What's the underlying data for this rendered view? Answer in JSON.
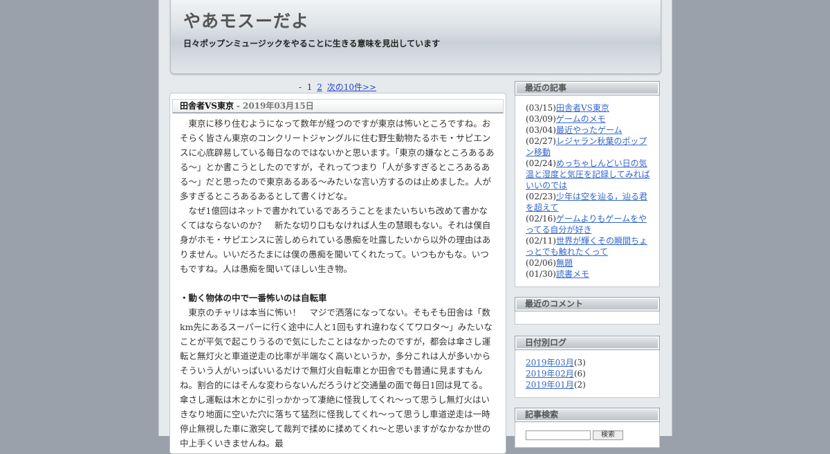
{
  "site": {
    "title": "やあモスーだよ",
    "description": "日々ポップンミュージックをやることに生きる意味を見出しています"
  },
  "pager": {
    "dash": "-",
    "current": "1",
    "page2": "2",
    "next": "次の10件>>"
  },
  "entry": {
    "title": "田舎者VS東京",
    "date": "- 2019年03月15日",
    "paragraphs": [
      "　東京に移り住むようになって数年が経つのですが東京は怖いところですね。おそらく皆さん東京のコンクリートジャングルに住む野生動物たるホモ・サピエンスに心底辟易している毎日なのではないかと思います。「東京の嫌なところあるある～」とか書こうとしたのですが，それってつまり「人が多すぎるところあるある～」だと思ったので東京あるある～みたいな言い方するのは止めました。人が多すぎるところあるあるとして書くけどな。",
      "　なぜ1億回はネットで書かれているであろうことをまたいちいち改めて書かなくてはならないのか？　新たな切り口もなければ人生の慧眼もない。それは僕自身がホモ・サピエンスに苦しめられている愚痴を吐露したいから以外の理由はありません。いいだろたまには僕の愚痴を聞いてくれたって。いつもかもな。いつもですね。人は愚痴を聞いてほしい生き物。",
      "・動く物体の中で一番怖いのは自転車",
      "　東京のチャリは本当に怖い！　マジで洒落になってない。そもそも田舎は「数km先にあるスーパーに行く途中に人と1回もすれ違わなくてワロタ～」みたいなことが平気で起こりうるので気にしたことはなかったのですが，都会は傘さし運転と無灯火と車道逆走の比率が半端なく高いというか，多分これは人が多いからそういう人がいっぱいいるだけで無灯火自転車とか田舎でも普通に見ますもんね。割合的にはそんな変わらないんだろうけど交通量の面で毎日1回は見てる。傘さし運転は木とかに引っかかって凄絶に怪我してくれ～って思うし無灯火はいきなり地面に空いた穴に落ちて猛烈に怪我してくれ～って思うし車道逆走は一時停止無視した車に激突して裁判で揉めに揉めてくれ～と思いますがなかなか世の中上手くいきませんね。最"
    ]
  },
  "sidebar": {
    "recent_entries": {
      "title": "最近の記事",
      "items": [
        {
          "date": "(03/15)",
          "label": "田舎者VS東京"
        },
        {
          "date": "(03/09)",
          "label": "ゲームのメモ"
        },
        {
          "date": "(03/04)",
          "label": "最近やったゲーム"
        },
        {
          "date": "(02/27)",
          "label": "レジャラン秋葉のポップン移動"
        },
        {
          "date": "(02/24)",
          "label": "めっちゃしんどい日の気温と湿度と気圧を記録してみればいいのでは"
        },
        {
          "date": "(02/23)",
          "label": "少年は空を辿る，辿る君を超えて"
        },
        {
          "date": "(02/16)",
          "label": "ゲームよりもゲームをやってる自分が好き"
        },
        {
          "date": "(02/11)",
          "label": "世界が輝くその瞬間ちょっとでも触れたくって"
        },
        {
          "date": "(02/06)",
          "label": "無題"
        },
        {
          "date": "(01/30)",
          "label": "読書メモ"
        }
      ]
    },
    "recent_comments": {
      "title": "最近のコメント"
    },
    "archives": {
      "title": "日付別ログ",
      "items": [
        {
          "label": "2019年03月",
          "count": "(3)"
        },
        {
          "label": "2019年02月",
          "count": "(6)"
        },
        {
          "label": "2019年01月",
          "count": "(2)"
        }
      ]
    },
    "search": {
      "title": "記事検索",
      "button": "検索"
    }
  }
}
